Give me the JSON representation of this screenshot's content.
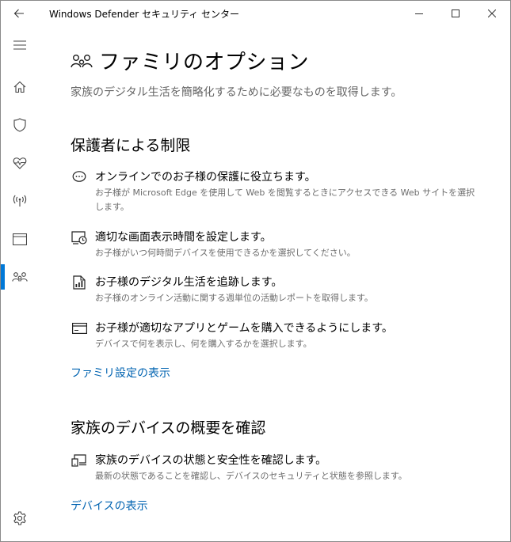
{
  "window": {
    "title": "Windows Defender セキュリティ センター"
  },
  "sidebar": {
    "items": [
      {
        "name": "menu",
        "icon": "hamburger-menu-icon"
      },
      {
        "name": "home",
        "icon": "home-icon"
      },
      {
        "name": "virus-protection",
        "icon": "shield-icon"
      },
      {
        "name": "device-performance",
        "icon": "heart-pulse-icon"
      },
      {
        "name": "firewall",
        "icon": "wireless-signal-icon"
      },
      {
        "name": "app-browser-control",
        "icon": "browser-window-icon"
      },
      {
        "name": "family-options",
        "icon": "family-icon",
        "active": true
      },
      {
        "name": "settings",
        "icon": "gear-icon"
      }
    ],
    "accent_color": "#0078d7"
  },
  "page": {
    "title": "ファミリのオプション",
    "description": "家族のデジタル生活を簡略化するために必要なものを取得します。"
  },
  "parental": {
    "heading": "保護者による制限",
    "items": [
      {
        "icon": "chat-bubble-icon",
        "title": "オンラインでのお子様の保護に役立ちます。",
        "desc": "お子様が Microsoft Edge を使用して Web を閲覧するときにアクセスできる Web サイトを選択します。"
      },
      {
        "icon": "screen-time-icon",
        "title": "適切な画面表示時間を設定します。",
        "desc": "お子様がいつ何時間デバイスを使用できるかを選択してください。"
      },
      {
        "icon": "activity-report-icon",
        "title": "お子様のデジタル生活を追跡します。",
        "desc": "お子様のオンライン活動に関する週単位の活動レポートを取得します。"
      },
      {
        "icon": "credit-card-icon",
        "title": "お子様が適切なアプリとゲームを購入できるようにします。",
        "desc": "デバイスで何を表示し、何を購入するかを選択します。"
      }
    ],
    "link": "ファミリ設定の表示"
  },
  "devices": {
    "heading": "家族のデバイスの概要を確認",
    "items": [
      {
        "icon": "devices-icon",
        "title": "家族のデバイスの状態と安全性を確認します。",
        "desc": "最新の状態であることを確認し、デバイスのセキュリティと状態を参照します。"
      }
    ],
    "link": "デバイスの表示"
  },
  "colors": {
    "link": "#0063b1",
    "secondary_text": "#666666"
  }
}
